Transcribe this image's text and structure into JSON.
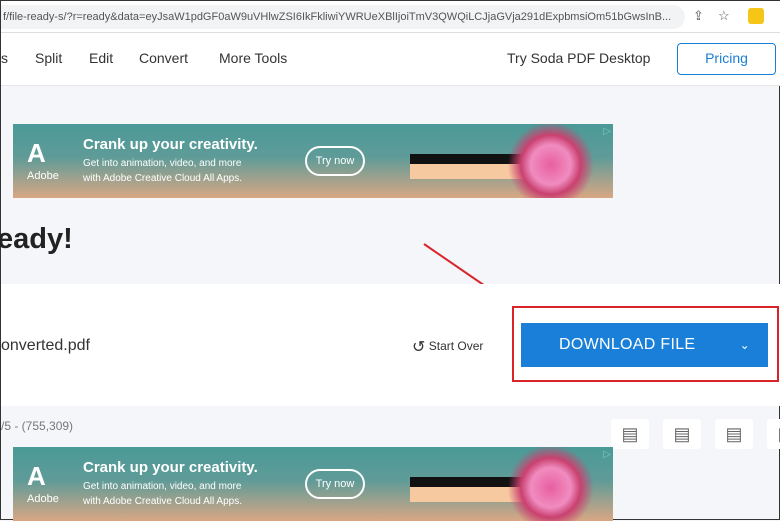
{
  "browser": {
    "url": "f/file-ready-s/?r=ready&data=eyJsaW1pdGF0aW9uVHlwZSI6IkFkliwiYWRUeXBlIjoiTmV3QWQiLCJjaGVja291dExpbmsiOm51bGwsInB...",
    "share_icon": "share-icon",
    "star_icon": "star-icon"
  },
  "nav": {
    "items": [
      "s",
      "Split",
      "Edit",
      "Convert",
      "More Tools"
    ],
    "try_desktop": "Try Soda PDF Desktop",
    "pricing": "Pricing"
  },
  "ad": {
    "brand": "Adobe",
    "headline": "Crank up your creativity.",
    "line1": "Get into animation, video, and more",
    "line2": "with Adobe Creative Cloud All Apps.",
    "cta": "Try now"
  },
  "page": {
    "title": "eady!",
    "file_name": "onverted.pdf",
    "start_over": "Start Over",
    "download": "DOWNLOAD FILE",
    "meta": "/5 - (755,309)"
  },
  "colors": {
    "primary": "#1a7fd8",
    "annotation": "#d9252a"
  }
}
